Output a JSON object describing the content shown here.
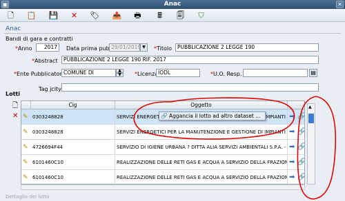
{
  "window": {
    "title": "Anac"
  },
  "toolbar": {
    "icons": [
      "new-doc-icon",
      "copy-icon",
      "save-icon",
      "delete-icon",
      "tag-icon",
      "export-icon",
      "print-icon",
      "calculator-icon",
      "shield-icon"
    ]
  },
  "app": {
    "title": "Anac"
  },
  "form": {
    "group_label": "Bandi di gara e contratti",
    "anno_label": "Anno",
    "anno_value": "2017",
    "data_label": "Data prima pubb.",
    "data_value": "29/01/2019",
    "titolo_label": "Titolo",
    "titolo_value": "PUBBLICAZIONE 2 LEGGE 190",
    "abstract_label": "Abstract",
    "abstract_value": "PUBBLICAZIONE 2 LEGGE 190 RIF. 2017",
    "ente_label": "Ente Pubblicatore",
    "ente_value": "COMUNE DI",
    "licenza_label": "Licenza",
    "licenza_value": "IODL",
    "uo_label": "U.O. Resp.",
    "uo_value": "",
    "tag_label": "Tag jcity",
    "tag_value": ""
  },
  "lotti": {
    "label": "Lotti",
    "columns": [
      "Cig",
      "Oggetto"
    ],
    "rows": [
      {
        "cig": "0303248828",
        "oggetto": "SERVIZI ENERGETICI PER LA MANUTENZIONE E GESTIONE DI IMPIANTI FOTC"
      },
      {
        "cig": "0303248828",
        "oggetto": "SERVIZI ENERGETICI PER LA MANUTENZIONE E GESTIONE DI IMPIANTI FOTC"
      },
      {
        "cig": "4726694F44",
        "oggetto": "SERVIZIO DI IGIENE URBANA ? DITTA ALIA SERVIZI AMBIENTALI S.P.A. - IMP"
      },
      {
        "cig": "6101460C10",
        "oggetto": "REALIZZAZIONE DELLE RETI GAS E ACQUA A SERVIZIO DELLA FRAZIONE DI S"
      },
      {
        "cig": "6101460C10",
        "oggetto": "REALIZZAZIONE DELLE RETI GAS E ACQUA A SERVIZIO DELLA FRAZIONE DI S"
      }
    ]
  },
  "context_menu": {
    "item": "Aggancia il lotto ad altro dataset ..."
  },
  "bottom": {
    "label": "Dettaglio del lotto"
  },
  "colors": {
    "annotation": "#e00000",
    "titlebar": "#3a5a80",
    "selected_row": "#cfe4f7"
  }
}
